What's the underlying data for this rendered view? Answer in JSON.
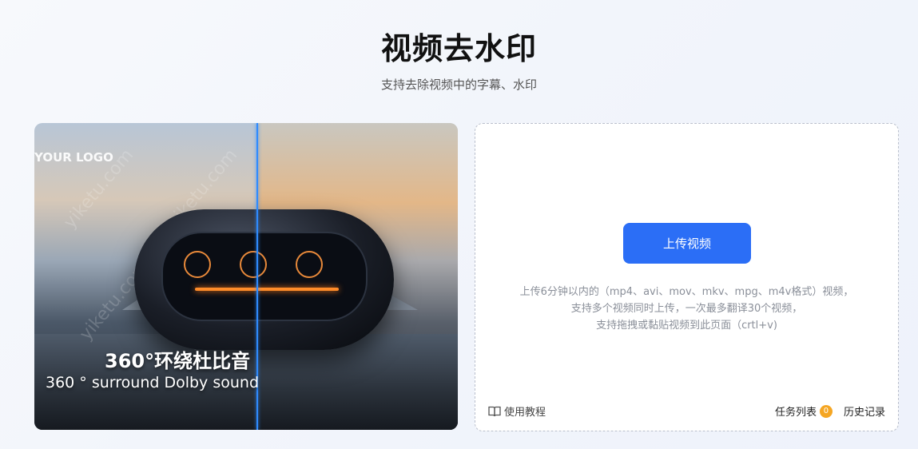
{
  "header": {
    "title": "视频去水印",
    "subtitle": "支持去除视频中的字幕、水印"
  },
  "preview": {
    "logo_text": "YOUR LOGO",
    "watermark_text": "yiketu.com",
    "caption_cn": "360°环绕杜比音",
    "caption_en": "360 ° surround Dolby sound",
    "divider_color": "#2f8bff"
  },
  "upload": {
    "button_label": "上传视频",
    "hint_lines": [
      "上传6分钟以内的（mp4、avi、mov、mkv、mpg、m4v格式）视频，",
      "支持多个视频同时上传，一次最多翻译30个视频，",
      "支持拖拽或黏贴视频到此页面（crtl+v)"
    ],
    "button_color": "#2b6ef6"
  },
  "footer": {
    "tutorial_label": "使用教程",
    "tutorial_icon": "book-icon",
    "task_list_label": "任务列表",
    "task_count": "0",
    "history_label": "历史记录",
    "badge_color": "#f5a623"
  }
}
